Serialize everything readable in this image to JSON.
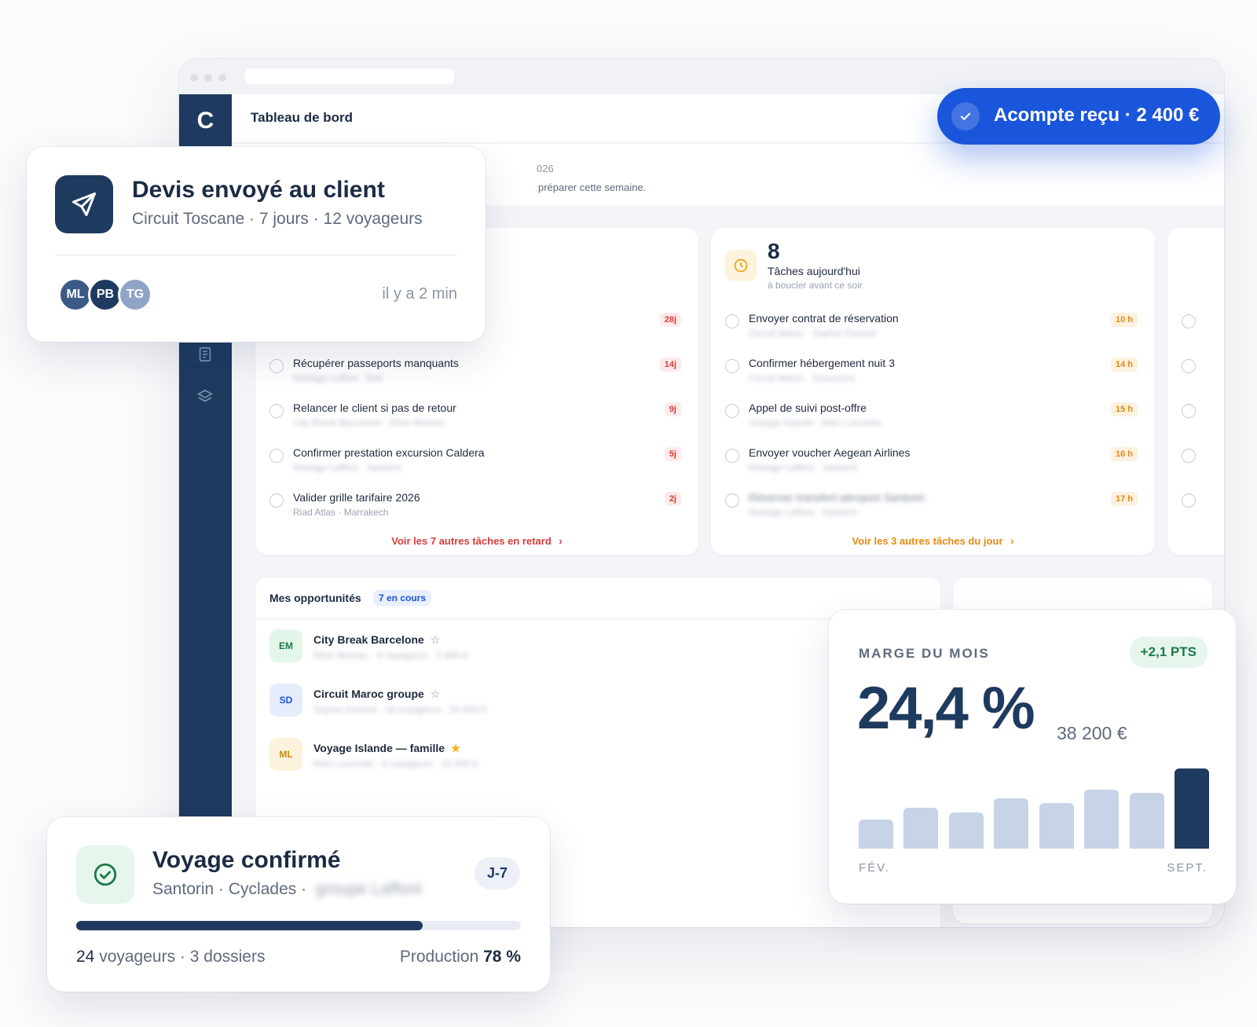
{
  "app": {
    "logo_letter": "C",
    "page_title": "Tableau de bord",
    "greeting_date_fragment": "026",
    "greeting_text_fragment": "préparer cette semaine."
  },
  "late_tasks": {
    "rows": [
      {
        "title": "",
        "subtitle": "",
        "badge": "28j"
      },
      {
        "title": "Récupérer passeports manquants",
        "subtitle": "Mariage Laffont · Bali",
        "badge": "14j"
      },
      {
        "title": "Relancer le client si pas de retour",
        "subtitle": "City Break Barcelone · Elise Moreau",
        "badge": "9j"
      },
      {
        "title": "Confirmer prestation excursion Caldera",
        "subtitle": "Mariage Laffont · Santorin",
        "badge": "5j"
      },
      {
        "title": "Valider grille tarifaire 2026",
        "subtitle": "Riad Atlas · Marrakech",
        "badge": "2j"
      }
    ],
    "see_all": "Voir les 7 autres tâches en retard",
    "chevron": "›"
  },
  "today_tasks": {
    "count": "8",
    "title": "Tâches aujourd'hui",
    "subtitle": "à boucler avant ce soir",
    "rows": [
      {
        "title": "Envoyer contrat de réservation",
        "subtitle": "Circuit Maroc · Sophie Durand",
        "badge": "10 h"
      },
      {
        "title": "Confirmer hébergement nuit 3",
        "subtitle": "Circuit Maroc · Essaouira",
        "badge": "14 h"
      },
      {
        "title": "Appel de suivi post-offre",
        "subtitle": "Voyage Islande · Marc Lecomte",
        "badge": "15 h"
      },
      {
        "title": "Envoyer voucher Aegean Airlines",
        "subtitle": "Mariage Laffont · Santorin",
        "badge": "16 h"
      },
      {
        "title": "Réserver transfert aéroport Santorin",
        "subtitle": "Mariage Laffont · Santorin",
        "badge": "17 h"
      }
    ],
    "see_all": "Voir les 3 autres tâches du jour",
    "chevron": "›"
  },
  "opportunities": {
    "title": "Mes opportunités",
    "badge": "7 en cours",
    "rows": [
      {
        "initials": "EM",
        "name": "City Break Barcelone",
        "sub": "Elise Moreau · 4 voyageurs · 5 800 €",
        "star": "☆"
      },
      {
        "initials": "SD",
        "name": "Circuit Maroc groupe",
        "sub": "Sophie Durand · 18 voyageurs · 24 600 €",
        "star": "☆"
      },
      {
        "initials": "ML",
        "name": "Voyage Islande — famille",
        "sub": "Marc Lecomte · 5 voyageurs · 16 400 €",
        "star": "★"
      }
    ]
  },
  "toast": {
    "text": "Acompte reçu · 2 400 €"
  },
  "quote_card": {
    "title": "Devis envoyé au client",
    "subtitle": "Circuit Toscane · 7 jours · 12 voyageurs",
    "avatars": [
      "ML",
      "PB",
      "TG"
    ],
    "time": "il y a 2 min"
  },
  "margin_card": {
    "label": "MARGE DU MOIS",
    "delta": "+2,1 PTS",
    "value": "24,4 %",
    "amount": "38 200 €",
    "start_label": "FÉV.",
    "end_label": "SEPT."
  },
  "chart_data": {
    "type": "bar",
    "categories": [
      "FÉV.",
      "",
      "",
      "",
      "",
      "",
      "",
      "SEPT."
    ],
    "values": [
      36,
      50,
      44,
      62,
      56,
      72,
      68,
      98
    ],
    "ylim": [
      0,
      100
    ],
    "highlight_index": 7,
    "colors": {
      "default": "#c7d3e6",
      "highlight": "#1f3a5f"
    }
  },
  "trip_card": {
    "title": "Voyage confirmé",
    "subtitle": "Santorin · Cyclades ·",
    "subtitle_blurred": "groupe Laffont",
    "countdown": "J-7",
    "progress": 0.78,
    "travelers": "24",
    "travelers_label": "voyageurs · 3 dossiers",
    "production_label": "Production",
    "production_value": "78 %"
  },
  "colors": {
    "navy": "#1f3a5f",
    "blue": "#1a56db",
    "red": "#d63b3b",
    "orange": "#e58a11",
    "green": "#1d7a4a"
  }
}
